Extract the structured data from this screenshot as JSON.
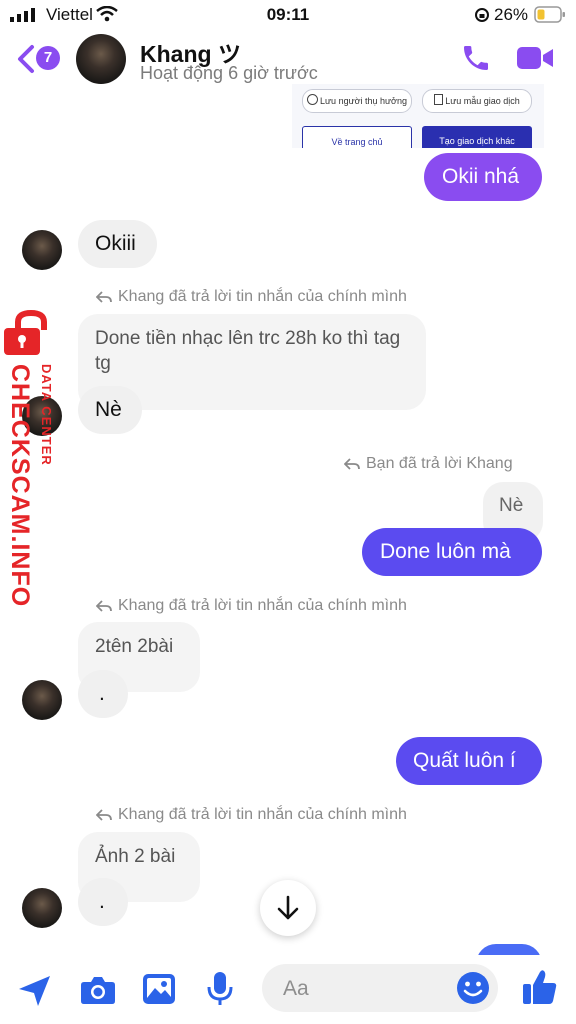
{
  "status_bar": {
    "carrier": "Viettel",
    "time": "09:11",
    "battery": "26%"
  },
  "header": {
    "unread_count": "7",
    "contact_name": "Khang ツ",
    "contact_status": "Hoạt động 6 giờ trước"
  },
  "shared_screenshot": {
    "save_beneficiary": "Lưu người thụ hưởng",
    "save_template": "Lưu mẫu giao dịch",
    "home_button": "Về trang chủ",
    "new_transaction_button": "Tạo giao dịch khác"
  },
  "messages": {
    "m1": "Okii nhá",
    "m2": "Okiii",
    "reply_note_1": "Khang đã trả lời tin nhắn của chính mình",
    "m3_quoted": "Done tiền nhạc lên trc 28h ko thì tag tg",
    "m3": "Nè",
    "reply_note_2": "Bạn đã trả lời Khang",
    "m4_quoted": "Nè",
    "m4": "Done luôn mà",
    "reply_note_3": "Khang đã trả lời tin nhắn của chính mình",
    "m5_quoted": "2tên 2bài",
    "m5": ".",
    "m6": "Quất luôn í",
    "reply_note_4": "Khang đã trả lời tin nhắn của chính mình",
    "m7_quoted": "Ảnh 2 bài",
    "m7": "."
  },
  "composer": {
    "placeholder": "Aa"
  },
  "watermark": {
    "top": "DATA CENTER",
    "main": "CHECKSCAM.INFO"
  },
  "colors": {
    "accent": "#8a4cf0",
    "outgoing": "#5b4bf0",
    "watermark": "#e52528"
  }
}
